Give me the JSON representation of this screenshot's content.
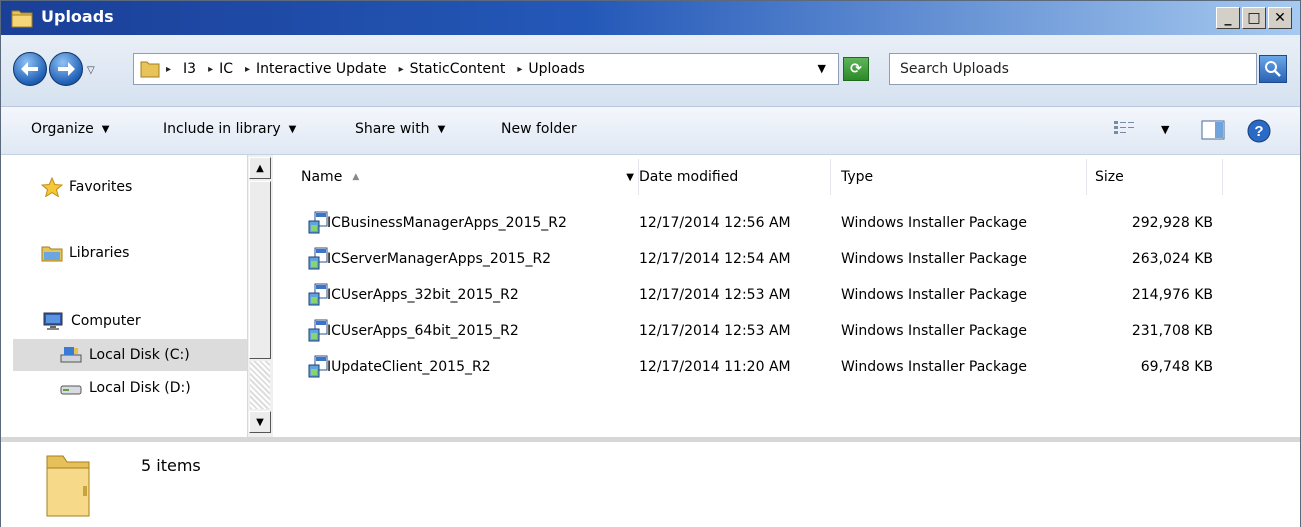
{
  "window": {
    "title": "Uploads",
    "controls": {
      "minimize": "_",
      "maximize": "□",
      "close": "✕"
    }
  },
  "address": {
    "breadcrumbs": [
      "I3",
      "IC",
      "Interactive Update",
      "StaticContent",
      "Uploads"
    ],
    "search_placeholder": "Search Uploads"
  },
  "toolbar": {
    "organize": "Organize",
    "include_in_library": "Include in library",
    "share_with": "Share with",
    "new_folder": "New folder"
  },
  "nav": {
    "favorites": "Favorites",
    "libraries": "Libraries",
    "computer": "Computer",
    "disk_c": "Local Disk (C:)",
    "disk_d": "Local Disk (D:)"
  },
  "columns": {
    "name": "Name",
    "date": "Date modified",
    "type": "Type",
    "size": "Size"
  },
  "files": [
    {
      "name": "ICBusinessManagerApps_2015_R2",
      "date": "12/17/2014 12:56 AM",
      "type": "Windows Installer Package",
      "size": "292,928 KB"
    },
    {
      "name": "ICServerManagerApps_2015_R2",
      "date": "12/17/2014 12:54 AM",
      "type": "Windows Installer Package",
      "size": "263,024 KB"
    },
    {
      "name": "ICUserApps_32bit_2015_R2",
      "date": "12/17/2014 12:53 AM",
      "type": "Windows Installer Package",
      "size": "214,976 KB"
    },
    {
      "name": "ICUserApps_64bit_2015_R2",
      "date": "12/17/2014 12:53 AM",
      "type": "Windows Installer Package",
      "size": "231,708 KB"
    },
    {
      "name": "IUpdateClient_2015_R2",
      "date": "12/17/2014 11:20 AM",
      "type": "Windows Installer Package",
      "size": "69,748 KB"
    }
  ],
  "details": {
    "item_count": "5 items"
  },
  "colors": {
    "titlebar": "#2458b8",
    "selection": "#dcdcdc",
    "toolbar": "#dfe8f4"
  }
}
